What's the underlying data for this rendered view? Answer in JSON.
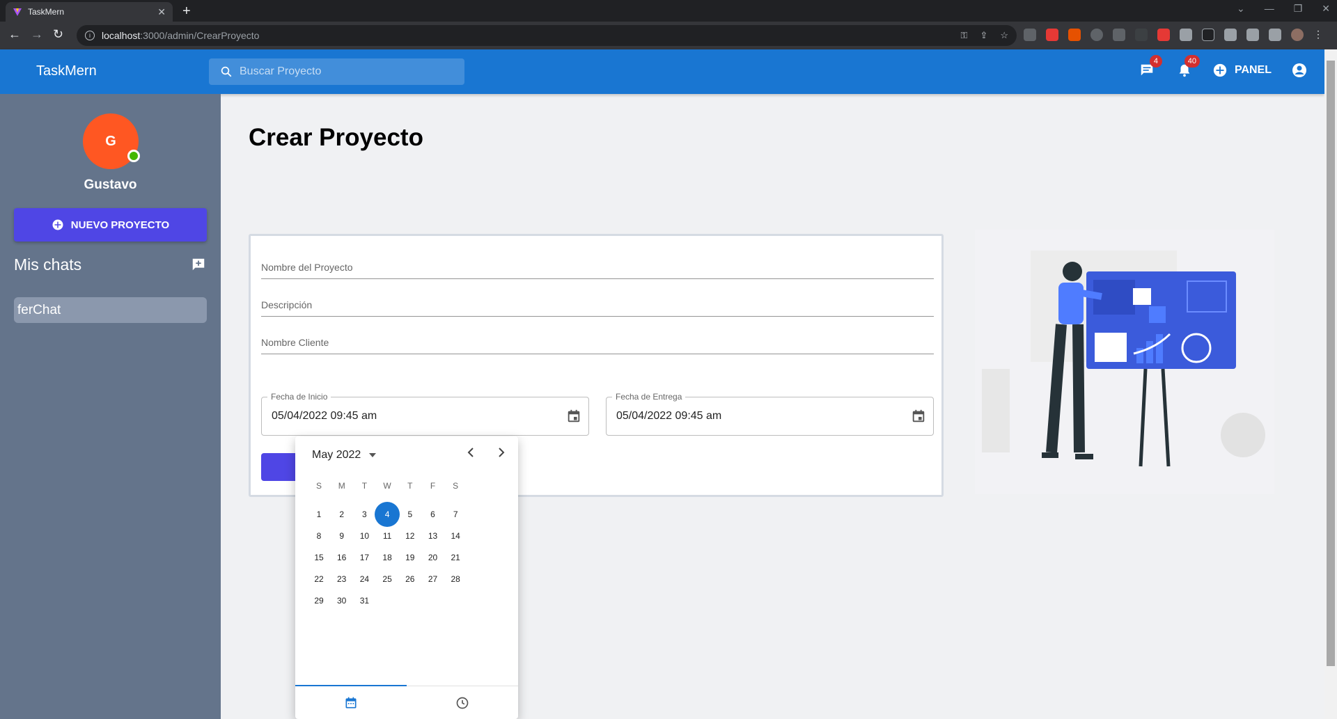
{
  "browser": {
    "tab_title": "TaskMern",
    "url_host": "localhost",
    "url_path": ":3000/admin/CrearProyecto"
  },
  "appbar": {
    "brand": "TaskMern",
    "search_placeholder": "Buscar Proyecto",
    "messages_badge": "4",
    "notifications_badge": "40",
    "panel_label": "PANEL",
    "color": "#1976d2"
  },
  "sidebar": {
    "avatar_letter": "G",
    "username": "Gustavo",
    "new_project_label": "NUEVO PROYECTO",
    "chats_title": "Mis chats",
    "chats": [
      {
        "name": "ferChat"
      }
    ],
    "bg_color": "#64748b",
    "accent_color": "#4f46e5"
  },
  "main": {
    "title": "Crear Proyecto",
    "fields": {
      "name_placeholder": "Nombre del Proyecto",
      "description_placeholder": "Descripción",
      "client_placeholder": "Nombre Cliente"
    },
    "start_date": {
      "label": "Fecha de Inicio",
      "value": "05/04/2022 09:45 am"
    },
    "end_date": {
      "label": "Fecha de Entrega",
      "value": "05/04/2022 09:45 am"
    }
  },
  "date_picker": {
    "month_label": "May",
    "year_label": "2022",
    "weekdays": [
      "S",
      "M",
      "T",
      "W",
      "T",
      "F",
      "S"
    ],
    "first_weekday_index": 0,
    "days_in_month": 31,
    "selected_day": 4,
    "tabs": [
      "calendar-icon",
      "clock-icon"
    ]
  }
}
